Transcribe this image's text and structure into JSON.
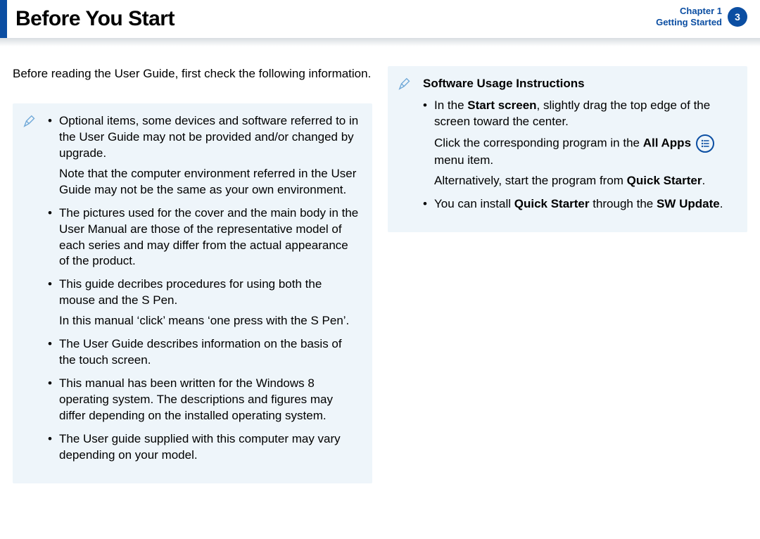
{
  "header": {
    "title": "Before You Start",
    "chapter_line1": "Chapter 1",
    "chapter_line2": "Getting Started",
    "page_number": "3"
  },
  "intro": "Before reading the User Guide, first check the following information.",
  "left_box": {
    "items": [
      {
        "text": "Optional items, some devices and software referred to in the User Guide may not be provided and/or changed by upgrade.",
        "sub": "Note that the computer environment referred in the User Guide may not be the same as your own environment."
      },
      {
        "text": "The pictures used for the cover and the main body in the User Manual are those of the representative model of each series and may differ from the actual appearance of the product."
      },
      {
        "text": "This guide decribes procedures for using both the mouse and the S Pen.",
        "sub": "In this manual ‘click’ means ‘one press with the S Pen’."
      },
      {
        "text": "The User Guide describes information on the basis of the touch screen."
      },
      {
        "text": "This manual has been written for the Windows 8 operating system. The descriptions and figures may differ depending on the installed operating system."
      },
      {
        "text": "The User guide supplied with this computer may vary depending on your model."
      }
    ]
  },
  "right_box": {
    "title": "Software Usage Instructions",
    "item1_pre": "In the ",
    "item1_bold1": "Start screen",
    "item1_post1": ", slightly drag the top edge of the screen toward the center.",
    "item1_line2_pre": "Click the corresponding program in the ",
    "item1_line2_bold": "All Apps",
    "item1_line2_post": " menu item.",
    "item1_line3_pre": "Alternatively, start the program from ",
    "item1_line3_bold": "Quick Starter",
    "item1_line3_post": ".",
    "item2_pre": "You can install ",
    "item2_bold1": "Quick Starter",
    "item2_mid": " through the ",
    "item2_bold2": "SW Update",
    "item2_post": "."
  }
}
